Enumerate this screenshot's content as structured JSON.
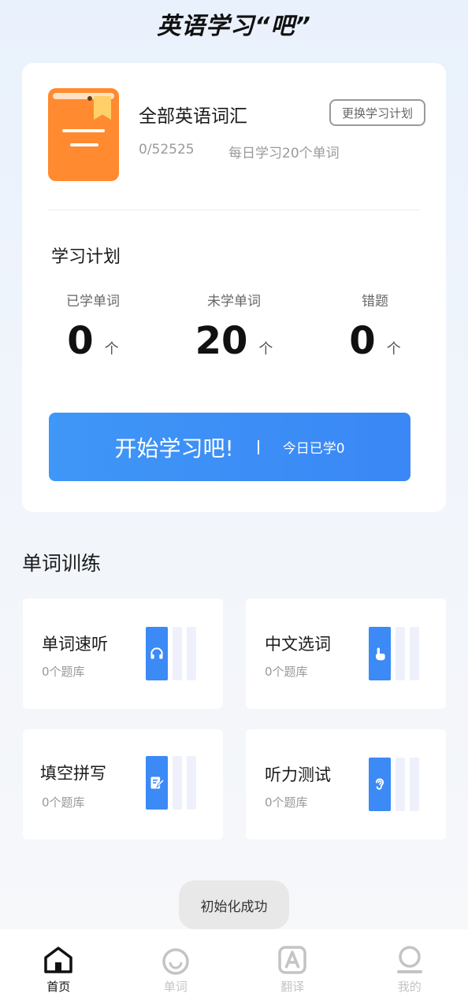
{
  "header": {
    "title": "英语学习“吧”"
  },
  "plan": {
    "book_title": "全部英语词汇",
    "change_plan_label": "更换学习计划",
    "progress": "0/52525",
    "daily_goal": "每日学习20个单词",
    "section_label": "学习计划",
    "stats": [
      {
        "label": "已学单词",
        "value": "0",
        "unit": "个"
      },
      {
        "label": "未学单词",
        "value": "20",
        "unit": "个"
      },
      {
        "label": "错题",
        "value": "0",
        "unit": "个"
      }
    ],
    "start_button": {
      "label": "开始学习吧!",
      "today": "今日已学0"
    }
  },
  "training": {
    "title": "单词训练",
    "items": [
      {
        "title": "单词速听",
        "subtitle": "0个题库",
        "icon": "headphones-icon"
      },
      {
        "title": "中文选词",
        "subtitle": "0个题库",
        "icon": "tap-hand-icon"
      },
      {
        "title": "填空拼写",
        "subtitle": "0个题库",
        "icon": "edit-note-icon"
      },
      {
        "title": "听力测试",
        "subtitle": "0个题库",
        "icon": "ear-icon"
      }
    ]
  },
  "toast": {
    "text": "初始化成功"
  },
  "tabs": [
    {
      "label": "首页",
      "icon": "home-icon",
      "active": true
    },
    {
      "label": "单词",
      "icon": "drop-icon",
      "active": false
    },
    {
      "label": "翻译",
      "icon": "letter-a-icon",
      "active": false
    },
    {
      "label": "我的",
      "icon": "profile-icon",
      "active": false
    }
  ],
  "colors": {
    "accent": "#3b8af5",
    "book": "#ff8a2f",
    "inactive_tab": "#c4c4c4"
  }
}
